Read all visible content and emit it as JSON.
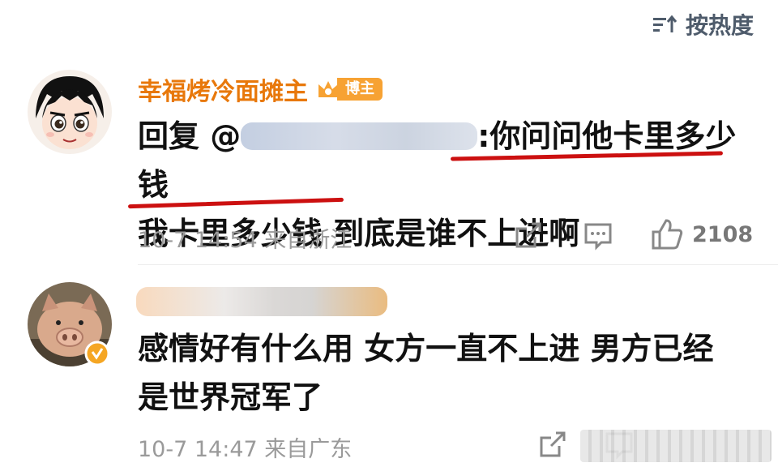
{
  "sort": {
    "icon": "sort-lines-icon",
    "label": "按热度"
  },
  "comments": [
    {
      "user_name": "幸福烤冷面摊主",
      "badge": "博主",
      "line1_prefix": "回复 @",
      "line1_rest": ":你问问他卡里多少钱",
      "line2_a": "我卡里多少钱",
      "line2_b": " 到底是谁不上进啊",
      "meta": "10-7 14:54 来自浙江",
      "likes": "2108"
    },
    {
      "line1": "感情好有什么用 女方一直不上进 男方已经",
      "line2": "是世界冠军了",
      "meta": "10-7 14:47 来自广东"
    }
  ],
  "colors": {
    "username": "#e8780b",
    "underline": "#cc1010",
    "meta": "#9a9a9a",
    "sort": "#4e5b6b"
  }
}
